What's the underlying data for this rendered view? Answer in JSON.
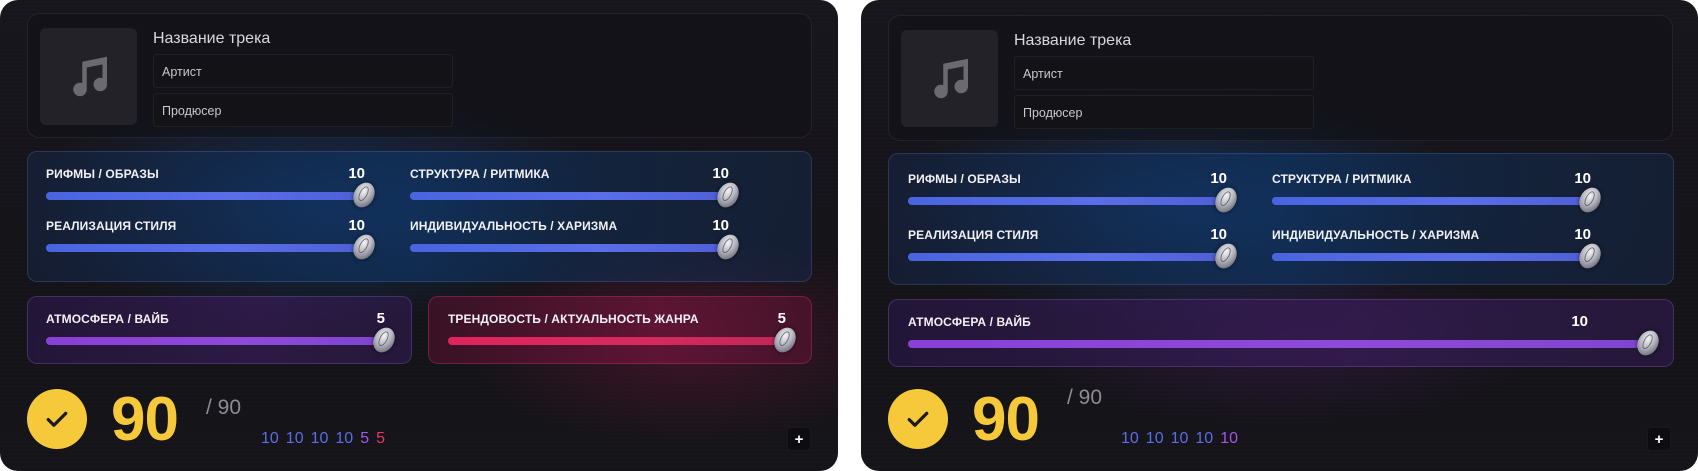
{
  "cards": [
    {
      "track_title": "Название трека",
      "artist_placeholder": "Артист",
      "producer_placeholder": "Продюсер",
      "criteria": [
        {
          "label": "РИФМЫ / ОБРАЗЫ",
          "value": "10",
          "fraction": 1.0
        },
        {
          "label": "СТРУКТУРА / РИТМИКА",
          "value": "10",
          "fraction": 1.0
        },
        {
          "label": "РЕАЛИЗАЦИЯ СТИЛЯ",
          "value": "10",
          "fraction": 1.0
        },
        {
          "label": "ИНДИВИДУАЛЬНОСТЬ / ХАРИЗМА",
          "value": "10",
          "fraction": 1.0
        }
      ],
      "extra": [
        {
          "label": "АТМОСФЕРА / ВАЙБ",
          "value": "5",
          "fraction": 1.0,
          "color": "#8e4ad8"
        },
        {
          "label": "ТРЕНДОВОСТЬ / АКТУАЛЬНОСТЬ ЖАНРА",
          "value": "5",
          "fraction": 1.0,
          "color": "#e0245c"
        }
      ],
      "total": "90",
      "max": "/ 90",
      "scores": [
        "10",
        "10",
        "10",
        "10",
        "5",
        "5"
      ],
      "plus_label": "+"
    },
    {
      "track_title": "Название трека",
      "artist_placeholder": "Артист",
      "producer_placeholder": "Продюсер",
      "criteria": [
        {
          "label": "РИФМЫ / ОБРАЗЫ",
          "value": "10",
          "fraction": 1.0
        },
        {
          "label": "СТРУКТУРА / РИТМИКА",
          "value": "10",
          "fraction": 1.0
        },
        {
          "label": "РЕАЛИЗАЦИЯ СТИЛЯ",
          "value": "10",
          "fraction": 1.0
        },
        {
          "label": "ИНДИВИДУАЛЬНОСТЬ / ХАРИЗМА",
          "value": "10",
          "fraction": 1.0
        }
      ],
      "extra": [
        {
          "label": "АТМОСФЕРА / ВАЙБ",
          "value": "10",
          "fraction": 1.0,
          "color": "#8e4ad8"
        }
      ],
      "total": "90",
      "max": "/ 90",
      "scores": [
        "10",
        "10",
        "10",
        "10",
        "10"
      ],
      "plus_label": "+"
    }
  ],
  "colors": {
    "accent_yellow": "#f6c93b",
    "blue": "#5a6ee8",
    "purple": "#a257e8",
    "pink": "#e6356a"
  },
  "icons": {
    "cover": "music-note-icon",
    "check": "checkmark-icon",
    "plus": "plus-icon"
  }
}
